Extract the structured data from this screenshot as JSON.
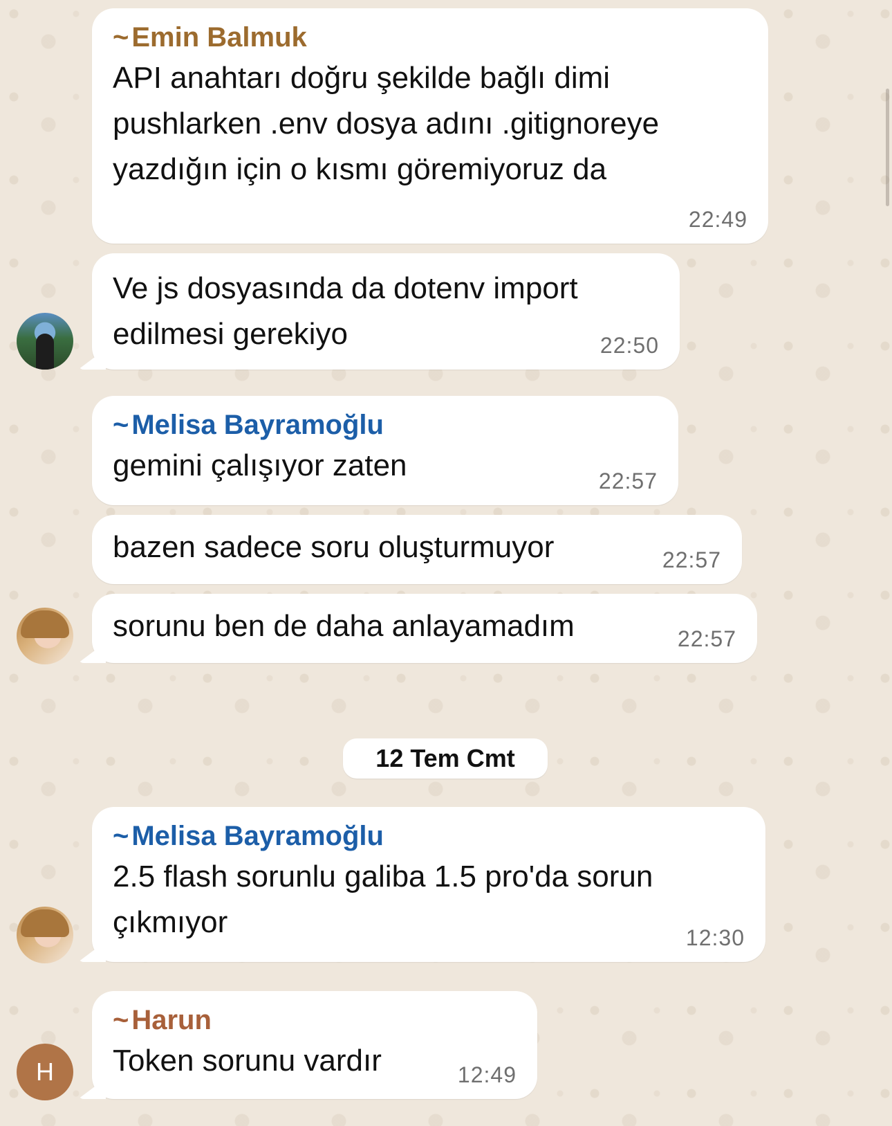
{
  "messages": [
    {
      "sender": "Emin Balmuk",
      "text": "API anahtarı doğru şekilde bağlı dimi\npushlarken .env dosya adını .gitignoreye\nyazdığın için o kısmı göremiyoruz da",
      "time": "22:49"
    },
    {
      "text": "Ve js dosyasında da dotenv import\nedilmesi gerekiyo",
      "time": "22:50"
    },
    {
      "sender": "Melisa Bayramoğlu",
      "text": "gemini çalışıyor zaten",
      "time": "22:57"
    },
    {
      "text": "bazen sadece soru oluşturmuyor",
      "time": "22:57"
    },
    {
      "text": "sorunu ben de daha anlayamadım",
      "time": "22:57"
    },
    {
      "sender": "Melisa Bayramoğlu",
      "text": "2.5 flash sorunlu galiba 1.5 pro'da sorun\nçıkmıyor",
      "time": "12:30"
    },
    {
      "sender": "Harun",
      "text": "Token sorunu vardır",
      "time": "12:49"
    }
  ],
  "date_separator": "12 Tem Cmt",
  "sender_prefix": "~",
  "avatars": {
    "harun_letter": "H"
  },
  "colors": {
    "wallpaper": "#efe7dc",
    "bubble": "#ffffff",
    "sender_emin": "#9c6b2e",
    "sender_melisa": "#1c5ea8",
    "sender_harun": "#a8603a",
    "avatar_harun": "#b07447"
  }
}
